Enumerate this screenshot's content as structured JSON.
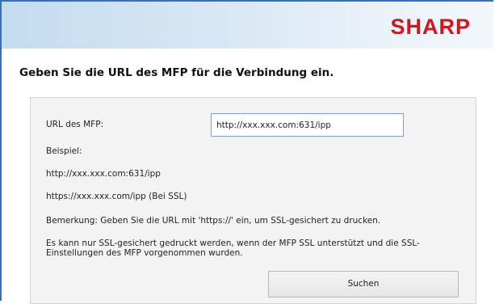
{
  "brand": {
    "logo": "SHARP",
    "logo_color": "#d4151c",
    "banner_color": "#c4dcef"
  },
  "heading": "Geben Sie die URL des MFP für die Verbindung ein.",
  "form": {
    "url_label": "URL des MFP:",
    "url_value": "http://xxx.xxx.com:631/ipp"
  },
  "examples": {
    "title": "Beispiel:",
    "items": [
      "http://xxx.xxx.com:631/ipp",
      "https://xxx.xxx.com/ipp (Bei SSL)"
    ]
  },
  "notes": {
    "remark": "Bemerkung: Geben Sie die URL mit 'https://' ein, um SSL-gesichert zu drucken.",
    "ssl_info": "Es kann nur SSL-gesichert gedruckt werden, wenn der MFP SSL unterstützt und die SSL-Einstellungen des MFP vorgenommen wurden."
  },
  "buttons": {
    "search_label": "Suchen"
  }
}
